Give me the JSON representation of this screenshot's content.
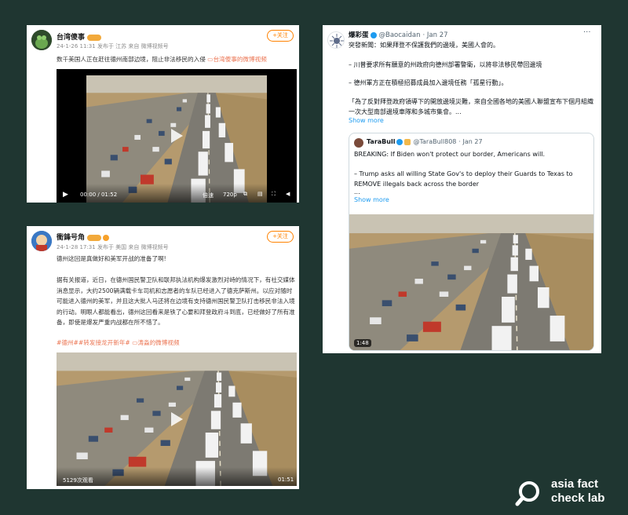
{
  "post1": {
    "username": "台湾傻事",
    "meta": "24-1-26 11:31 发布于 江苏 来自 微博视频号",
    "follow_label": "+关注",
    "text": "数千美国人正在赶往德州南部边境，阻止非法移民的入侵",
    "link_text": "台湾傻事的微博视频",
    "time": "00:00 / 01:52",
    "speed": "倍速",
    "quality": "720p"
  },
  "post2": {
    "username": "衝鋒号角",
    "meta": "24-1-28 17:31 发布于 美国 来自 微博视频号",
    "follow_label": "+关注",
    "line1": "德州这回是真做好和美军开战的准备了啊!",
    "para": "据有关报道，近日，在德州国民警卫队和联邦执法机构爆发激烈对峙的情况下，有社交媒体消息显示，大约2500辆满载卡车司机和志愿者的车队已经进入了德克萨斯州。以应对随时可能进入德州的美军，并且这大批人马还将在边境有支持德州国民警卫队打击移民非法入境的行动。明眼人都能看出，德州这回看来是铁了心要和拜登政府斗到底，已经做好了所有准备，即使是爆发严重内战都在所不惜了。",
    "tags": "#德州##转发接龙开新年#",
    "link_text": "涛淼的微博视频",
    "views": "5129次观看",
    "duration": "01:51"
  },
  "post3": {
    "name": "爆彩蛋",
    "handle": "@Baocaidan",
    "date": "· Jan 27",
    "line1": "突發新聞：如果拜登不保護我們的邊境，美國人會的。",
    "line2": "– 川普要求所有願意的州政府向德州部署警衛，以將非法移民帶回邊境",
    "line3": "– 德州軍方正在積極招募成員加入邊境任務「孤星行動」。",
    "line4": "「為了反對拜登政府領導下的開放邊境災難，來自全國各地的美國人聯盟宣布下個月組織一次大型南部邊境車隊和多城市集會。...",
    "show_more": "Show more",
    "quote": {
      "name": "TaraBull",
      "handle": "@TaraBull808",
      "date": "· Jan 27",
      "line1": "BREAKING: If Biden won't protect our border, Americans will.",
      "line2": "– Trump asks all willing State Gov's to deploy their Guards to Texas to REMOVE illegals back across the border",
      "line3": "...",
      "show_more": "Show more",
      "duration": "1:48"
    }
  },
  "logo": {
    "line1": "asia fact",
    "line2": "check lab"
  },
  "colors": {
    "background": "#1f3631",
    "weibo_orange": "#ff8200",
    "x_blue": "#1d9bf0"
  }
}
